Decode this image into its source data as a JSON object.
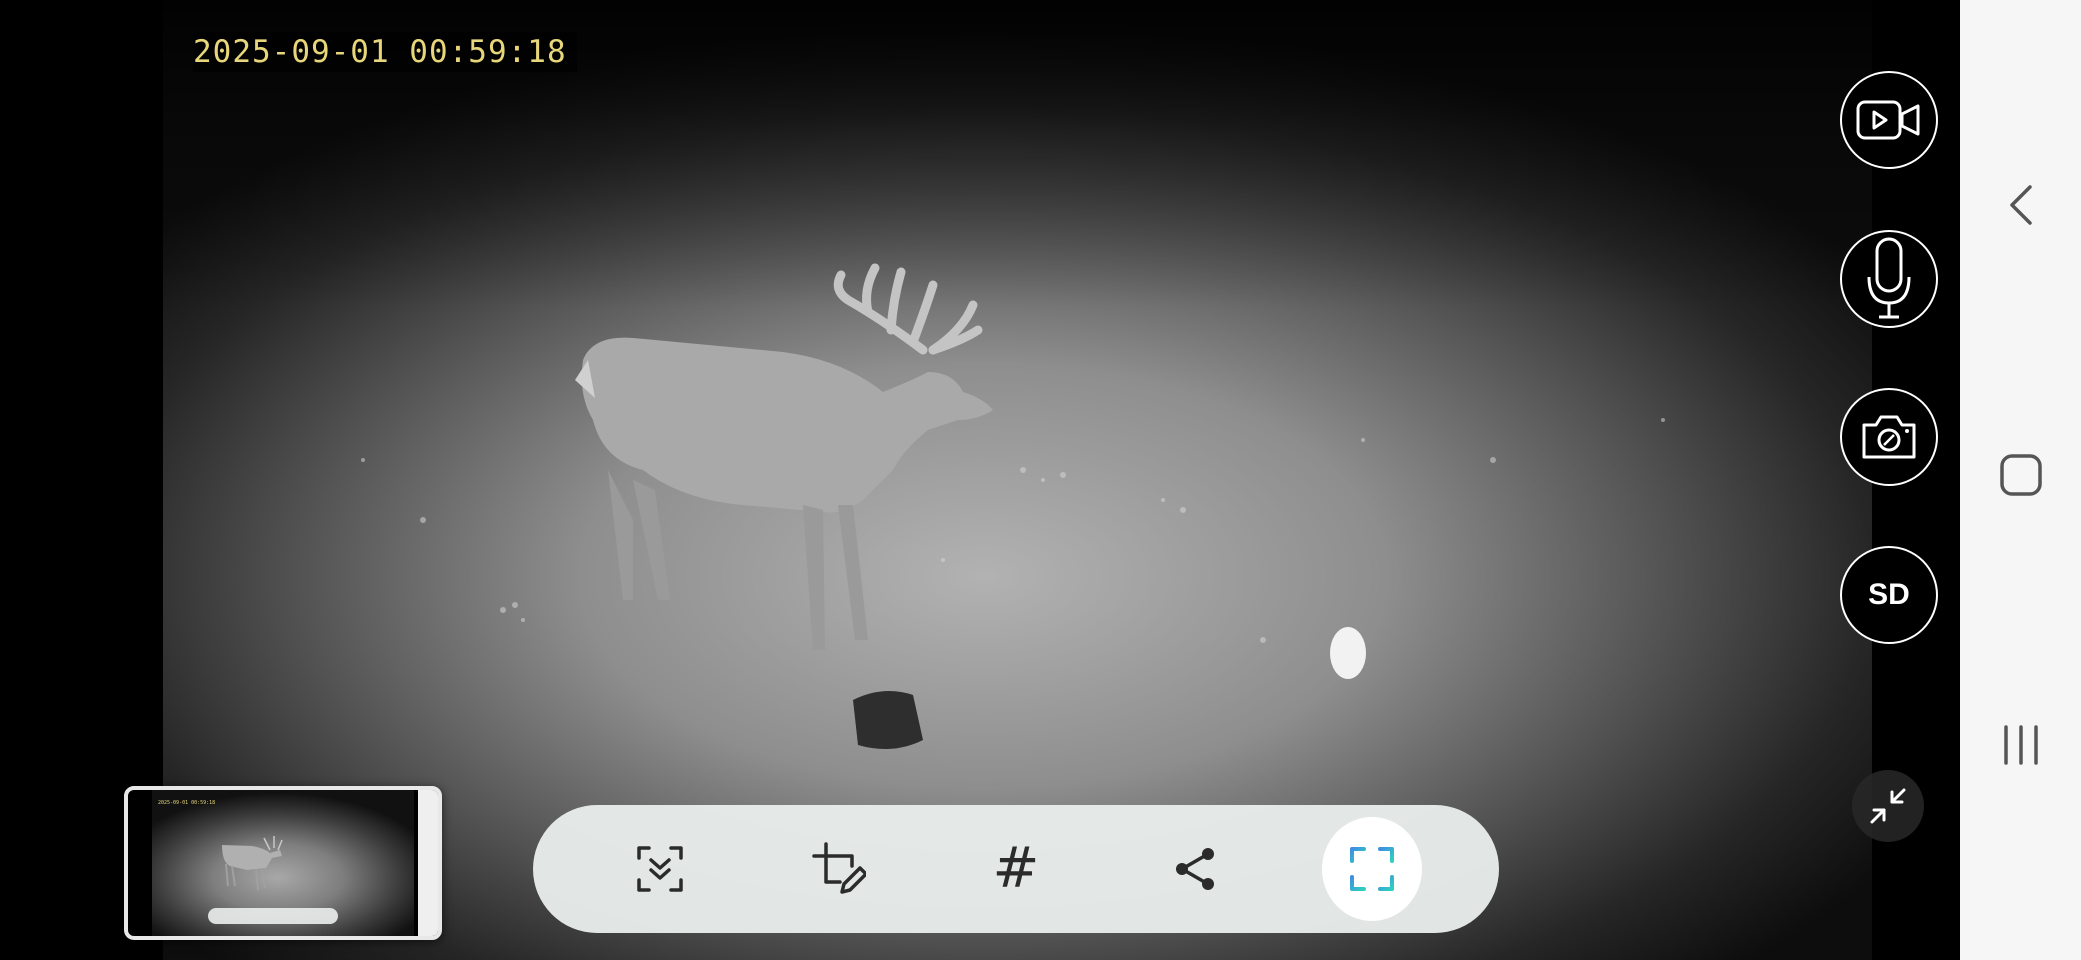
{
  "camera": {
    "timestamp": "2025-09-01 00:59:18"
  },
  "controls": {
    "record_icon": "video-camera-icon",
    "talk_icon": "microphone-icon",
    "snapshot_icon": "camera-icon",
    "quality_label": "SD",
    "exit_fullscreen_icon": "collapse-arrows-icon"
  },
  "screenshot_toolbar": {
    "items": [
      {
        "name": "scroll-capture",
        "icon": "scroll-capture-icon"
      },
      {
        "name": "crop-draw",
        "icon": "crop-edit-icon"
      },
      {
        "name": "tag",
        "label": "#",
        "icon": "hashtag-icon"
      },
      {
        "name": "share",
        "icon": "share-icon"
      },
      {
        "name": "expand",
        "icon": "expand-frame-icon",
        "active": true
      }
    ]
  },
  "thumbnail": {
    "timestamp": "2025-09-01 00:59:18"
  },
  "system_nav": {
    "back_icon": "back-chevron-icon",
    "home_icon": "home-square-icon",
    "recents_icon": "recents-bars-icon"
  },
  "colors": {
    "timestamp_text": "#e8d77a",
    "toolbar_bg": "#e8ecea",
    "accent_expand": "#3f8fe0",
    "accent_expand_teal": "#2fd0c0",
    "nav_bg": "#f6f6f6"
  }
}
